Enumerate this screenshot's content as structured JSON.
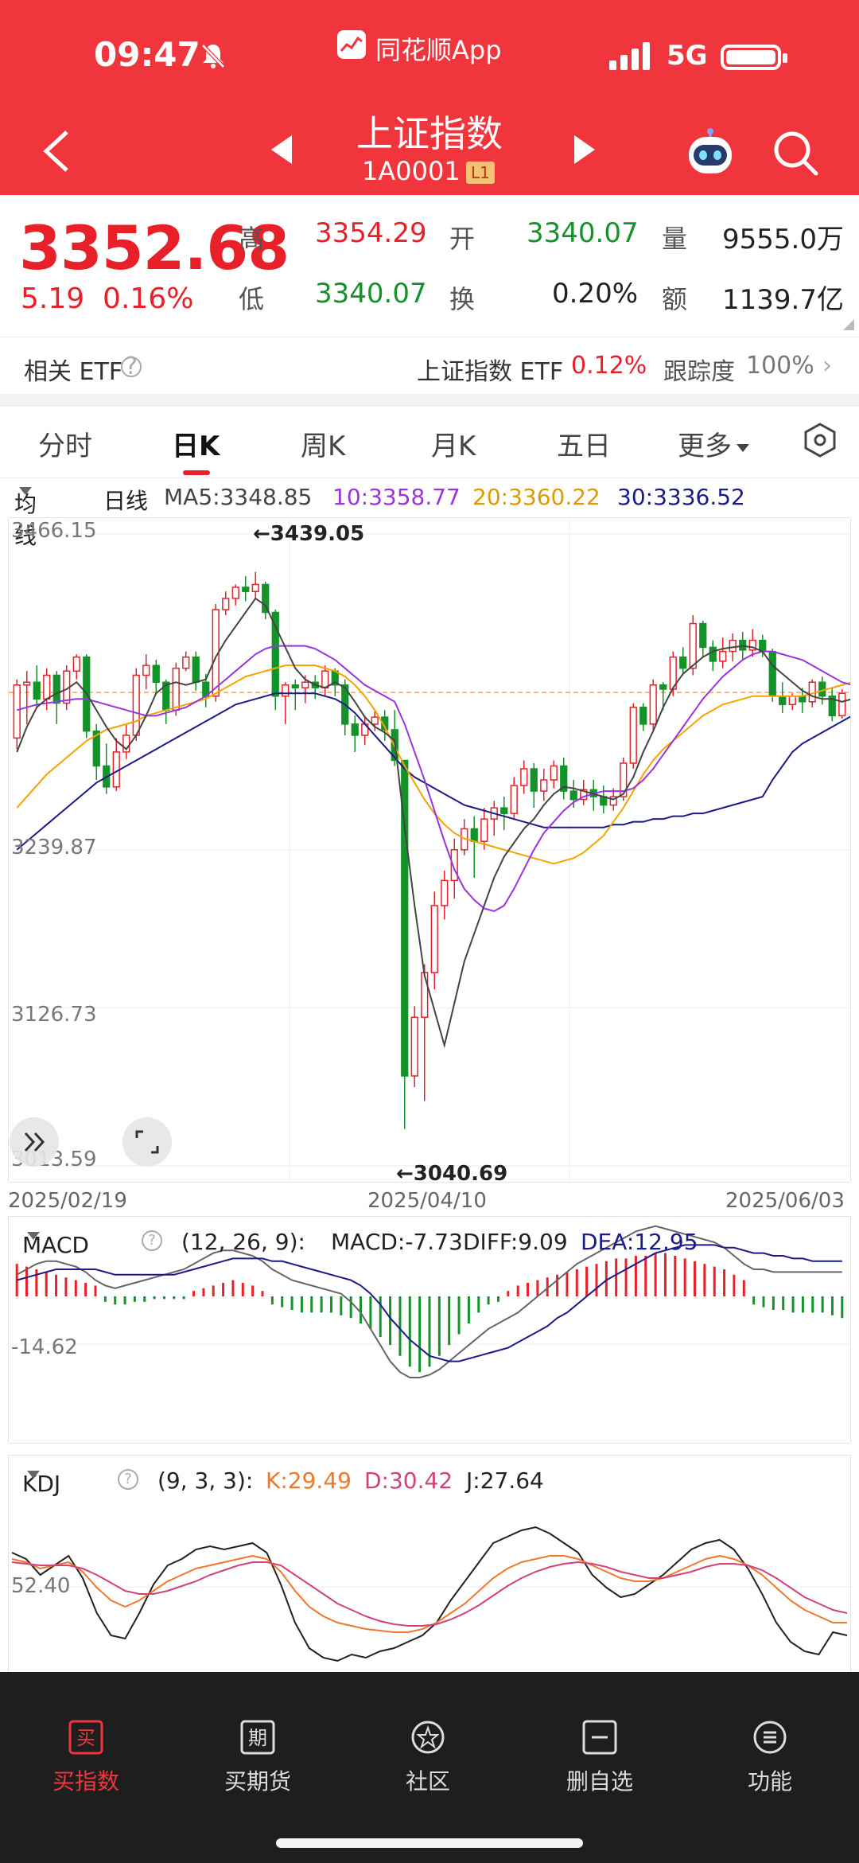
{
  "status_bar": {
    "time": "09:47",
    "app_name": "同花顺App",
    "network": "5G"
  },
  "header": {
    "title": "上证指数",
    "code": "1A0001",
    "level_badge": "L1"
  },
  "quote": {
    "price": "3352.68",
    "change": "5.19",
    "change_pct": "0.16%",
    "high_label": "高",
    "high": "3354.29",
    "open_label": "开",
    "open": "3340.07",
    "volume_label": "量",
    "volume": "9555.0万",
    "low_label": "低",
    "low": "3340.07",
    "turnover_label": "换",
    "turnover": "0.20%",
    "amount_label": "额",
    "amount": "1139.7亿"
  },
  "etf": {
    "label": "相关 ETF",
    "help": "?",
    "name": "上证指数 ETF",
    "pct": "0.12%",
    "track_label": "跟踪度",
    "track": "100%"
  },
  "tabs": [
    {
      "label": "分时"
    },
    {
      "label": "日K"
    },
    {
      "label": "周K"
    },
    {
      "label": "月K"
    },
    {
      "label": "五日"
    },
    {
      "label": "更多"
    }
  ],
  "ma_legend": {
    "selector": "均线",
    "period": "日线",
    "ma5": "MA5:3348.85",
    "ma10": "10:3358.77",
    "ma20": "20:3360.22",
    "ma30": "30:3336.52"
  },
  "colors": {
    "up": "#e8202a",
    "down": "#13932a",
    "ma5": "#444444",
    "ma10": "#9a33e0",
    "ma20": "#f5a300",
    "ma30": "#1a1a8a",
    "k": "#f07828",
    "d": "#d4407a",
    "j": "#222222"
  },
  "chart_data": [
    {
      "type": "candlestick",
      "x_start": "2025/02/19",
      "x_mid": "2025/04/10",
      "x_end": "2025/06/03",
      "y_ticks": [
        "3466.15",
        "3239.87",
        "3126.73",
        "3013.59"
      ],
      "ylim": [
        3013.59,
        3466.15
      ],
      "annotations": [
        "←3439.05",
        "←3040.69"
      ],
      "ref_line": 3352.68,
      "candles": [
        [
          3320,
          3358,
          3312,
          3362
        ],
        [
          3358,
          3360,
          3330,
          3368
        ],
        [
          3360,
          3348,
          3342,
          3372
        ],
        [
          3348,
          3365,
          3340,
          3370
        ],
        [
          3365,
          3345,
          3330,
          3368
        ],
        [
          3345,
          3368,
          3340,
          3372
        ],
        [
          3368,
          3378,
          3362,
          3380
        ],
        [
          3378,
          3325,
          3320,
          3380
        ],
        [
          3325,
          3300,
          3290,
          3330
        ],
        [
          3300,
          3285,
          3280,
          3316
        ],
        [
          3285,
          3310,
          3282,
          3320
        ],
        [
          3310,
          3322,
          3305,
          3330
        ],
        [
          3322,
          3365,
          3318,
          3370
        ],
        [
          3365,
          3372,
          3355,
          3380
        ],
        [
          3372,
          3360,
          3352,
          3376
        ],
        [
          3360,
          3340,
          3330,
          3362
        ],
        [
          3340,
          3370,
          3336,
          3374
        ],
        [
          3370,
          3378,
          3368,
          3382
        ],
        [
          3378,
          3360,
          3354,
          3382
        ],
        [
          3360,
          3350,
          3342,
          3366
        ],
        [
          3350,
          3412,
          3346,
          3416
        ],
        [
          3412,
          3420,
          3408,
          3425
        ],
        [
          3420,
          3428,
          3415,
          3430
        ],
        [
          3428,
          3425,
          3418,
          3436
        ],
        [
          3425,
          3430,
          3420,
          3439
        ],
        [
          3430,
          3410,
          3405,
          3432
        ],
        [
          3410,
          3350,
          3340,
          3412
        ],
        [
          3350,
          3358,
          3330,
          3360
        ],
        [
          3358,
          3356,
          3340,
          3362
        ],
        [
          3356,
          3360,
          3345,
          3365
        ],
        [
          3360,
          3356,
          3348,
          3365
        ],
        [
          3356,
          3368,
          3350,
          3372
        ],
        [
          3368,
          3358,
          3350,
          3370
        ],
        [
          3358,
          3330,
          3322,
          3362
        ],
        [
          3330,
          3322,
          3310,
          3336
        ],
        [
          3322,
          3330,
          3315,
          3336
        ],
        [
          3330,
          3335,
          3325,
          3340
        ],
        [
          3335,
          3326,
          3318,
          3340
        ],
        [
          3326,
          3304,
          3300,
          3340
        ],
        [
          3304,
          3078,
          3040,
          3170
        ],
        [
          3078,
          3120,
          3070,
          3128
        ],
        [
          3120,
          3152,
          3060,
          3158
        ],
        [
          3152,
          3200,
          3140,
          3210
        ],
        [
          3200,
          3218,
          3190,
          3225
        ],
        [
          3218,
          3240,
          3205,
          3248
        ],
        [
          3240,
          3255,
          3236,
          3262
        ],
        [
          3255,
          3246,
          3220,
          3264
        ],
        [
          3246,
          3262,
          3240,
          3270
        ],
        [
          3262,
          3270,
          3250,
          3275
        ],
        [
          3270,
          3266,
          3254,
          3278
        ],
        [
          3266,
          3286,
          3262,
          3292
        ],
        [
          3286,
          3298,
          3280,
          3304
        ],
        [
          3298,
          3282,
          3270,
          3302
        ],
        [
          3282,
          3290,
          3275,
          3298
        ],
        [
          3290,
          3300,
          3284,
          3304
        ],
        [
          3300,
          3282,
          3276,
          3306
        ],
        [
          3282,
          3276,
          3270,
          3290
        ],
        [
          3276,
          3283,
          3272,
          3290
        ],
        [
          3283,
          3278,
          3268,
          3290
        ],
        [
          3278,
          3272,
          3266,
          3286
        ],
        [
          3272,
          3278,
          3268,
          3284
        ],
        [
          3278,
          3302,
          3275,
          3306
        ],
        [
          3302,
          3342,
          3298,
          3345
        ],
        [
          3342,
          3330,
          3325,
          3345
        ],
        [
          3330,
          3358,
          3326,
          3362
        ],
        [
          3358,
          3355,
          3340,
          3360
        ],
        [
          3355,
          3378,
          3350,
          3382
        ],
        [
          3378,
          3370,
          3365,
          3385
        ],
        [
          3370,
          3402,
          3365,
          3408
        ],
        [
          3402,
          3385,
          3378,
          3404
        ],
        [
          3385,
          3375,
          3368,
          3390
        ],
        [
          3375,
          3382,
          3370,
          3392
        ],
        [
          3382,
          3390,
          3375,
          3395
        ],
        [
          3390,
          3383,
          3376,
          3396
        ],
        [
          3383,
          3390,
          3378,
          3398
        ],
        [
          3390,
          3382,
          3378,
          3394
        ],
        [
          3382,
          3350,
          3346,
          3384
        ],
        [
          3350,
          3344,
          3338,
          3360
        ],
        [
          3344,
          3350,
          3340,
          3352
        ],
        [
          3350,
          3346,
          3338,
          3356
        ],
        [
          3346,
          3360,
          3342,
          3362
        ],
        [
          3360,
          3350,
          3344,
          3364
        ],
        [
          3350,
          3336,
          3332,
          3356
        ],
        [
          3336,
          3352,
          3334,
          3355
        ]
      ],
      "ma5": [
        3310,
        3328,
        3342,
        3348,
        3352,
        3355,
        3360,
        3352,
        3340,
        3328,
        3318,
        3312,
        3322,
        3336,
        3352,
        3358,
        3360,
        3358,
        3360,
        3362,
        3378,
        3390,
        3400,
        3410,
        3420,
        3415,
        3400,
        3385,
        3370,
        3362,
        3358,
        3356,
        3360,
        3356,
        3346,
        3335,
        3328,
        3324,
        3318,
        3256,
        3200,
        3150,
        3125,
        3100,
        3130,
        3160,
        3180,
        3200,
        3220,
        3235,
        3245,
        3255,
        3262,
        3272,
        3280,
        3285,
        3284,
        3282,
        3280,
        3278,
        3276,
        3280,
        3292,
        3310,
        3325,
        3342,
        3356,
        3366,
        3372,
        3378,
        3382,
        3384,
        3385,
        3386,
        3385,
        3382,
        3372,
        3366,
        3360,
        3354,
        3350,
        3348,
        3348,
        3346,
        3348
      ],
      "ma10": [
        3340,
        3342,
        3344,
        3345,
        3346,
        3347,
        3348,
        3348,
        3346,
        3344,
        3342,
        3340,
        3338,
        3336,
        3336,
        3338,
        3340,
        3342,
        3346,
        3350,
        3356,
        3362,
        3368,
        3374,
        3380,
        3384,
        3386,
        3386,
        3386,
        3386,
        3384,
        3380,
        3376,
        3370,
        3364,
        3358,
        3354,
        3350,
        3346,
        3330,
        3310,
        3290,
        3268,
        3246,
        3226,
        3212,
        3204,
        3198,
        3196,
        3200,
        3212,
        3226,
        3240,
        3252,
        3260,
        3268,
        3274,
        3278,
        3280,
        3282,
        3282,
        3282,
        3284,
        3290,
        3298,
        3308,
        3318,
        3328,
        3338,
        3348,
        3356,
        3364,
        3370,
        3376,
        3380,
        3382,
        3382,
        3380,
        3378,
        3376,
        3372,
        3368,
        3364,
        3360,
        3358
      ],
      "ma20": [
        3270,
        3278,
        3286,
        3294,
        3300,
        3306,
        3312,
        3318,
        3322,
        3326,
        3328,
        3330,
        3332,
        3336,
        3338,
        3340,
        3342,
        3344,
        3346,
        3348,
        3352,
        3356,
        3360,
        3364,
        3366,
        3368,
        3370,
        3372,
        3372,
        3372,
        3372,
        3370,
        3368,
        3364,
        3358,
        3350,
        3340,
        3328,
        3314,
        3300,
        3288,
        3276,
        3266,
        3258,
        3252,
        3248,
        3246,
        3244,
        3242,
        3240,
        3238,
        3236,
        3234,
        3232,
        3230,
        3232,
        3234,
        3238,
        3244,
        3250,
        3260,
        3270,
        3282,
        3294,
        3304,
        3312,
        3318,
        3324,
        3330,
        3336,
        3340,
        3344,
        3346,
        3348,
        3350,
        3350,
        3350,
        3350,
        3350,
        3350,
        3352,
        3354,
        3356,
        3358,
        3360
      ],
      "ma30": [
        3240,
        3246,
        3252,
        3258,
        3264,
        3270,
        3276,
        3282,
        3288,
        3292,
        3296,
        3300,
        3304,
        3308,
        3312,
        3316,
        3320,
        3324,
        3328,
        3332,
        3336,
        3340,
        3344,
        3346,
        3348,
        3350,
        3352,
        3352,
        3352,
        3352,
        3352,
        3350,
        3348,
        3344,
        3338,
        3330,
        3322,
        3314,
        3306,
        3298,
        3292,
        3288,
        3284,
        3280,
        3276,
        3272,
        3270,
        3268,
        3266,
        3264,
        3262,
        3260,
        3258,
        3256,
        3256,
        3256,
        3256,
        3256,
        3256,
        3256,
        3258,
        3258,
        3260,
        3260,
        3262,
        3262,
        3264,
        3264,
        3266,
        3266,
        3268,
        3270,
        3272,
        3274,
        3276,
        3278,
        3290,
        3300,
        3310,
        3316,
        3320,
        3324,
        3328,
        3332,
        3336
      ]
    },
    {
      "type": "macd",
      "selector": "MACD",
      "params": "(12, 26, 9):",
      "macd": "MACD:-7.73",
      "diff": "DIFF:9.09",
      "dea": "DEA:12.95",
      "y_tick": "-14.62",
      "hist": [
        12,
        11,
        10,
        9,
        8,
        7,
        6,
        5,
        4,
        -2,
        -3,
        -3,
        -2,
        -2,
        -1,
        -1,
        -1,
        -1,
        2,
        3,
        4,
        5,
        6,
        5,
        4,
        2,
        -3,
        -4,
        -5,
        -6,
        -6,
        -6,
        -6,
        -7,
        -8,
        -10,
        -12,
        -15,
        -18,
        -22,
        -26,
        -28,
        -26,
        -22,
        -18,
        -14,
        -10,
        -6,
        -3,
        -2,
        2,
        4,
        5,
        6,
        7,
        8,
        9,
        10,
        11,
        12,
        13,
        14,
        14,
        15,
        15,
        16,
        16,
        15,
        14,
        13,
        12,
        11,
        10,
        8,
        6,
        -3,
        -4,
        -5,
        -5,
        -6,
        -6,
        -6,
        -6,
        -7,
        -8
      ],
      "diff_line": [
        8,
        10,
        12,
        13,
        13,
        12,
        11,
        9,
        6,
        4,
        3,
        4,
        5,
        6,
        7,
        8,
        9,
        10,
        12,
        14,
        16,
        17,
        17,
        16,
        15,
        13,
        10,
        8,
        6,
        5,
        4,
        3,
        2,
        1,
        -2,
        -6,
        -12,
        -18,
        -24,
        -28,
        -30,
        -30,
        -29,
        -27,
        -24,
        -21,
        -18,
        -15,
        -12,
        -10,
        -8,
        -6,
        -3,
        0,
        3,
        6,
        9,
        12,
        14,
        16,
        18,
        20,
        22,
        24,
        25,
        26,
        25,
        24,
        23,
        22,
        21,
        20,
        18,
        15,
        12,
        10,
        10,
        9,
        9,
        9,
        9,
        9,
        9,
        9,
        9
      ],
      "dea_line": [
        6,
        7,
        8,
        9,
        10,
        10,
        10,
        10,
        10,
        9,
        8,
        8,
        8,
        8,
        8,
        8,
        8,
        9,
        10,
        11,
        12,
        13,
        14,
        14,
        14,
        14,
        13,
        13,
        12,
        11,
        10,
        9,
        8,
        7,
        6,
        4,
        1,
        -3,
        -8,
        -12,
        -16,
        -19,
        -22,
        -23,
        -24,
        -24,
        -23,
        -22,
        -21,
        -20,
        -19,
        -17,
        -15,
        -13,
        -11,
        -8,
        -6,
        -3,
        0,
        3,
        6,
        8,
        10,
        12,
        14,
        16,
        17,
        18,
        19,
        19,
        19,
        19,
        18,
        18,
        17,
        16,
        16,
        15,
        15,
        14,
        14,
        13,
        13,
        13,
        13
      ]
    },
    {
      "type": "kdj",
      "selector": "KDJ",
      "params": "(9, 3, 3):",
      "k": "K:29.49",
      "d": "D:30.42",
      "j": "J:27.64",
      "y_tick": "52.40",
      "k_line": [
        70,
        68,
        64,
        66,
        68,
        62,
        52,
        44,
        40,
        44,
        50,
        56,
        60,
        64,
        66,
        68,
        70,
        72,
        70,
        62,
        50,
        40,
        34,
        30,
        28,
        26,
        25,
        24,
        24,
        26,
        30,
        36,
        42,
        50,
        58,
        64,
        68,
        70,
        72,
        72,
        70,
        66,
        62,
        58,
        56,
        56,
        58,
        62,
        66,
        70,
        72,
        70,
        66,
        60,
        52,
        44,
        38,
        34,
        30,
        30
      ],
      "d_line": [
        68,
        67,
        66,
        66,
        66,
        64,
        60,
        55,
        50,
        48,
        48,
        50,
        53,
        56,
        60,
        63,
        66,
        68,
        68,
        66,
        60,
        54,
        48,
        42,
        38,
        34,
        31,
        29,
        28,
        28,
        29,
        32,
        36,
        41,
        47,
        53,
        58,
        62,
        65,
        67,
        68,
        67,
        65,
        62,
        60,
        58,
        58,
        60,
        62,
        65,
        67,
        67,
        66,
        63,
        58,
        52,
        46,
        42,
        38,
        36
      ],
      "j_line": [
        74,
        70,
        60,
        66,
        72,
        58,
        36,
        22,
        20,
        36,
        54,
        66,
        70,
        76,
        78,
        76,
        78,
        80,
        74,
        54,
        30,
        14,
        8,
        6,
        10,
        8,
        12,
        14,
        18,
        22,
        30,
        44,
        56,
        68,
        80,
        84,
        88,
        90,
        86,
        80,
        74,
        60,
        52,
        46,
        48,
        54,
        60,
        68,
        76,
        80,
        82,
        76,
        64,
        48,
        30,
        18,
        12,
        10,
        24,
        22
      ]
    }
  ],
  "bottom_nav": [
    {
      "label": "买指数",
      "icon": "buy-icon",
      "glyph": "买"
    },
    {
      "label": "买期货",
      "icon": "futures-icon",
      "glyph": "期"
    },
    {
      "label": "社区",
      "icon": "community-icon"
    },
    {
      "label": "删自选",
      "icon": "remove-watchlist-icon"
    },
    {
      "label": "功能",
      "icon": "menu-icon"
    }
  ]
}
